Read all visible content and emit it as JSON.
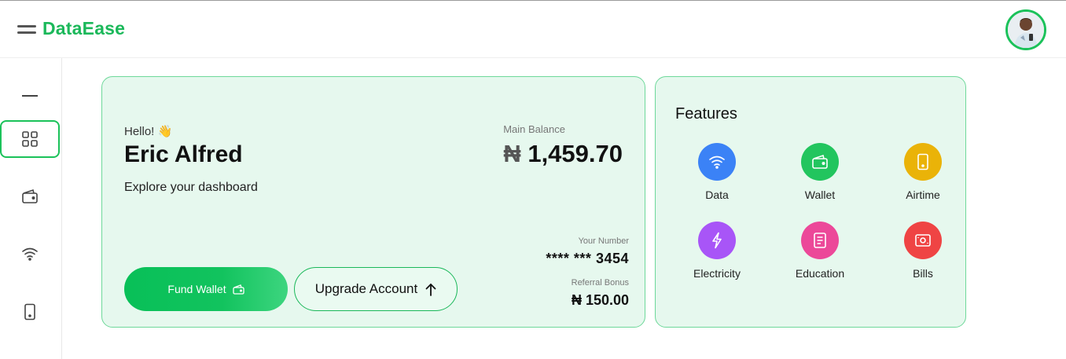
{
  "header": {
    "brand": "DataEase"
  },
  "welcome": {
    "greeting": "Hello! 👋",
    "user_name": "Eric Alfred",
    "subtitle": "Explore your dashboard",
    "main_balance_label": "Main Balance",
    "currency_symbol": "₦",
    "main_balance_value": "1,459.70",
    "your_number_label": "Your Number",
    "your_number_value": "**** *** 3454",
    "referral_bonus_label": "Referral Bonus",
    "referral_bonus_value": "₦ 150.00",
    "fund_wallet_label": "Fund Wallet",
    "upgrade_label": "Upgrade Account"
  },
  "features": {
    "title": "Features",
    "items": [
      {
        "label": "Data",
        "color": "#3b82f6",
        "icon": "wifi-icon"
      },
      {
        "label": "Wallet",
        "color": "#22c55e",
        "icon": "wallet-icon"
      },
      {
        "label": "Airtime",
        "color": "#eab308",
        "icon": "phone-icon"
      },
      {
        "label": "Electricity",
        "color": "#a855f7",
        "icon": "lightning-icon"
      },
      {
        "label": "Education",
        "color": "#ec4899",
        "icon": "book-icon"
      },
      {
        "label": "Bills",
        "color": "#ef4444",
        "icon": "banknote-icon"
      }
    ]
  },
  "colors": {
    "brand": "#1bb85a",
    "card_bg": "#e6f8ee",
    "card_border": "#6ed89a"
  }
}
